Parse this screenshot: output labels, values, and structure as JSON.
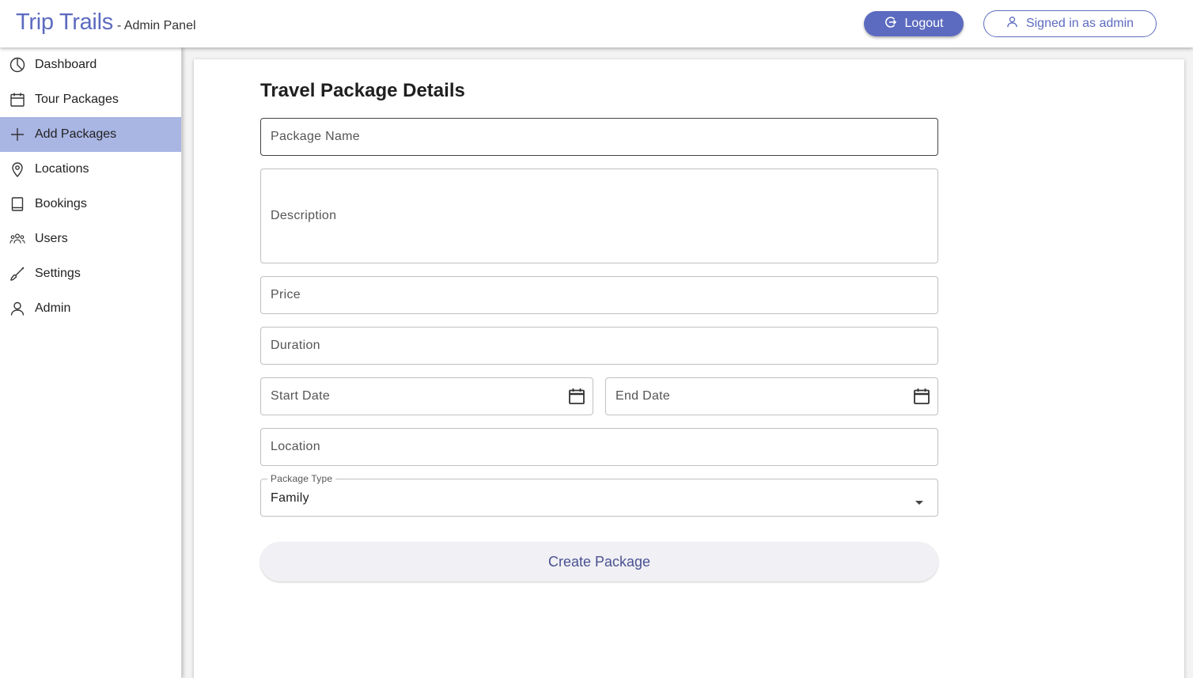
{
  "header": {
    "brand_name": "Trip Trails",
    "brand_sub": "- Admin Panel",
    "logout_label": "Logout",
    "signed_in_label": "Signed in as admin"
  },
  "sidebar": {
    "items": [
      {
        "label": "Dashboard",
        "icon": "pie-chart-icon"
      },
      {
        "label": "Tour Packages",
        "icon": "calendar-icon"
      },
      {
        "label": "Add Packages",
        "icon": "plus-icon",
        "active": true
      },
      {
        "label": "Locations",
        "icon": "map-pin-icon"
      },
      {
        "label": "Bookings",
        "icon": "book-icon"
      },
      {
        "label": "Users",
        "icon": "users-icon"
      },
      {
        "label": "Settings",
        "icon": "brush-icon"
      },
      {
        "label": "Admin",
        "icon": "user-icon"
      }
    ]
  },
  "form": {
    "title": "Travel Package Details",
    "package_name_placeholder": "Package Name",
    "description_placeholder": "Description",
    "price_placeholder": "Price",
    "duration_placeholder": "Duration",
    "start_date_placeholder": "Start Date",
    "end_date_placeholder": "End Date",
    "location_placeholder": "Location",
    "package_type_label": "Package Type",
    "package_type_value": "Family",
    "create_label": "Create Package"
  },
  "colors": {
    "accent": "#5c6bc0",
    "active_nav": "#a9b5e3"
  }
}
